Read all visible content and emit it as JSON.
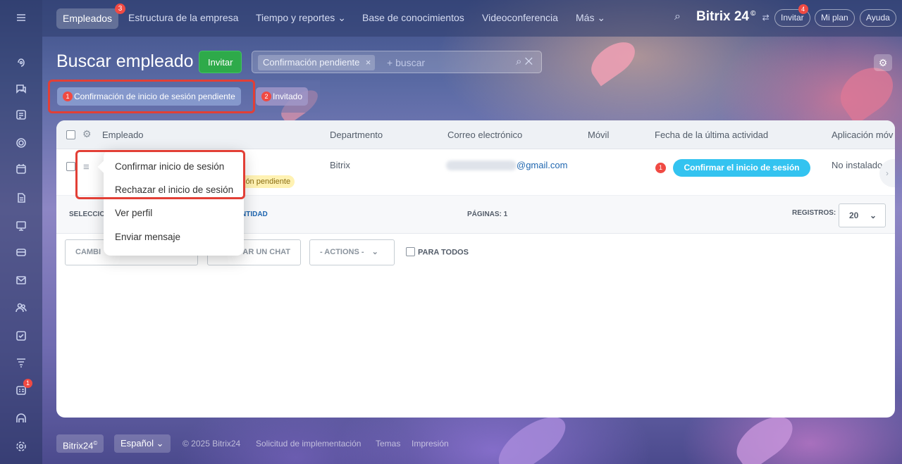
{
  "nav": {
    "items": [
      {
        "label": "Empleados",
        "badge": "3"
      },
      {
        "label": "Estructura de la empresa"
      },
      {
        "label": "Tiempo y reportes ⌄"
      },
      {
        "label": "Base de conocimientos"
      },
      {
        "label": "Videoconferencia"
      },
      {
        "label": "Más ⌄"
      }
    ],
    "brand": "Bitrix 24",
    "brand_mark": "©",
    "invite_label": "Invitar",
    "invite_badge": "4",
    "plan_label": "Mi plan",
    "help_label": "Ayuda"
  },
  "sidebar": {
    "calendar_badge": "1"
  },
  "page": {
    "title": "Buscar empleado",
    "invite_button": "Invitar",
    "search_chip": "Confirmación pendiente",
    "search_placeholder": "+ buscar"
  },
  "presets": [
    {
      "number": "1",
      "label": "Confirmación de inicio de sesión pendiente"
    },
    {
      "number": "2",
      "label": "Invitado"
    }
  ],
  "grid": {
    "columns": [
      "Empleado",
      "Departmento",
      "Correo electrónico",
      "Móvil",
      "Fecha de la última actividad",
      "Aplicación móv"
    ],
    "row": {
      "department": "Bitrix",
      "email_suffix": "@gmail.com",
      "status": "ión pendiente",
      "activity_badge": "1",
      "confirm_button": "Confirmar el inicio de sesión",
      "app": "No instalado"
    },
    "footer": {
      "selected": "SELECCIO",
      "quantity": "NTIDAD",
      "pages": "PÁGINAS: 1",
      "records": "REGISTROS:",
      "per_page": "20"
    },
    "actions": {
      "change": "CAMBI",
      "chat": "AR UN CHAT",
      "actions_select": "- ACTIONS -",
      "for_all": "PARA TODOS"
    }
  },
  "context_menu": {
    "items": [
      "Confirmar inicio de sesión",
      "Rechazar el inicio de sesión",
      "Ver perfil",
      "Enviar mensaje"
    ]
  },
  "footer": {
    "brand": "Bitrix24",
    "language": "Español",
    "copyright": "© 2025 Bitrix24",
    "implementation": "Solicitud de implementación",
    "themes": "Temas",
    "print": "Impresión"
  }
}
